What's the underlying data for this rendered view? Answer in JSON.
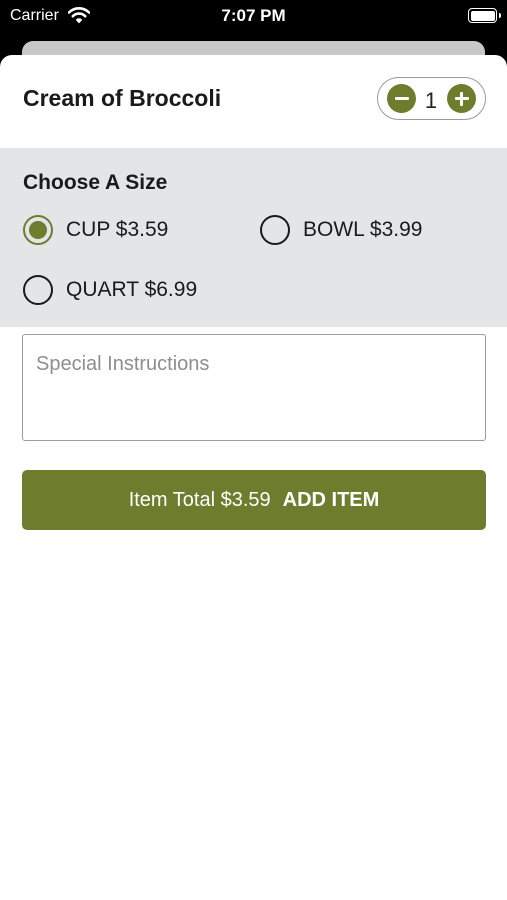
{
  "status_bar": {
    "carrier": "Carrier",
    "time": "7:07 PM",
    "icons": [
      "wifi-icon",
      "battery-icon"
    ]
  },
  "item": {
    "title": "Cream of Broccoli"
  },
  "quantity": {
    "value": "1",
    "icons": [
      "minus-circle-icon",
      "plus-circle-icon"
    ]
  },
  "size": {
    "heading": "Choose A Size",
    "selected": "CUP $3.59",
    "options": [
      {
        "label": "CUP $3.59",
        "selected": true
      },
      {
        "label": "BOWL $3.99",
        "selected": false
      },
      {
        "label": "QUART $6.99",
        "selected": false
      }
    ]
  },
  "instructions": {
    "placeholder": "Special Instructions",
    "value": ""
  },
  "add_button": {
    "total": "Item Total $3.59",
    "label": "ADD ITEM"
  },
  "colors": {
    "accent": "#6e7c2d",
    "section_bg": "#e4e5e7"
  }
}
